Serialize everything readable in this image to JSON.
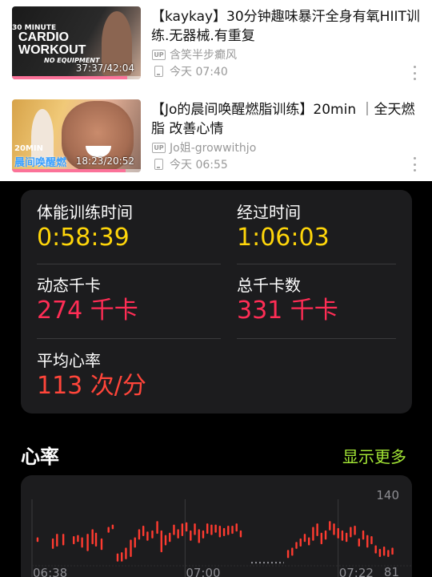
{
  "history": {
    "videos": [
      {
        "title": "【kaykay】30分钟趣味暴汗全身有氧HIIT训练.无器械.有重复",
        "uploader": "含笑半步癫风",
        "watched_time": "今天 07:40",
        "duration": "37:37/42:04",
        "progress": 0.894,
        "thumb_text": {
          "small": "30 MINUTE",
          "line1": "CARDIO",
          "line2": "WORKOUT",
          "sub": "NO EQUIPMENT"
        }
      },
      {
        "title": "【Jo的晨间唤醒燃脂训练】20min ｜全天燃脂 改善心情",
        "uploader": "Jo姐-growwithjo",
        "watched_time": "今天 06:55",
        "duration": "18:23/20:52",
        "progress": 0.881,
        "thumb_text": {
          "line1": "20MIN",
          "line2": "晨间唤醒燃"
        }
      }
    ],
    "up_badge": "UP",
    "icons": [
      "up-badge-icon",
      "device-icon",
      "more-vertical-icon"
    ]
  },
  "summary": {
    "workout_time_label": "体能训练时间",
    "workout_time_value": "0:58:39",
    "elapsed_label": "经过时间",
    "elapsed_value": "1:06:03",
    "active_kcal_label": "动态千卡",
    "active_kcal_value": "274 千卡",
    "total_kcal_label": "总千卡数",
    "total_kcal_value": "331 千卡",
    "avg_hr_label": "平均心率",
    "avg_hr_value": "113 次/分"
  },
  "heart_rate": {
    "title": "心率",
    "show_more": "显示更多"
  },
  "colors": {
    "yellow": "#ffd60a",
    "pink": "#ff2d55",
    "red": "#ff453a",
    "green": "#a3e635",
    "card_bg": "#1c1c1e",
    "bili_pink": "#fb7299"
  },
  "chart_data": {
    "type": "bar",
    "title": "",
    "x_tick_labels": [
      "06:38",
      "07:00",
      "07:22"
    ],
    "y_tick_labels": [
      "140",
      "81"
    ],
    "ylim": [
      81,
      140
    ],
    "bars": [
      [
        0.8,
        110,
        114
      ],
      [
        3.0,
        104,
        113
      ],
      [
        3.6,
        106,
        117
      ],
      [
        4.5,
        107,
        117
      ],
      [
        6.0,
        108,
        115
      ],
      [
        6.6,
        110,
        116
      ],
      [
        7.2,
        105,
        114
      ],
      [
        8.0,
        102,
        117
      ],
      [
        8.7,
        108,
        121
      ],
      [
        9.2,
        106,
        118
      ],
      [
        10.0,
        103,
        113
      ],
      [
        11.0,
        118,
        123
      ],
      [
        11.6,
        121,
        125
      ],
      [
        12.3,
        93,
        100
      ],
      [
        12.9,
        93,
        101
      ],
      [
        13.5,
        95,
        105
      ],
      [
        14.2,
        97,
        112
      ],
      [
        14.8,
        105,
        114
      ],
      [
        15.4,
        112,
        121
      ],
      [
        16.0,
        115,
        124
      ],
      [
        16.6,
        111,
        119
      ],
      [
        17.3,
        113,
        120
      ],
      [
        18.0,
        117,
        128
      ],
      [
        18.6,
        101,
        120
      ],
      [
        19.2,
        107,
        116
      ],
      [
        19.8,
        110,
        118
      ],
      [
        20.4,
        116,
        125
      ],
      [
        21.0,
        113,
        121
      ],
      [
        21.6,
        115,
        126
      ],
      [
        22.2,
        119,
        127
      ],
      [
        22.8,
        111,
        120
      ],
      [
        23.4,
        116,
        126
      ],
      [
        24.0,
        109,
        121
      ],
      [
        24.6,
        113,
        120
      ],
      [
        25.2,
        117,
        126
      ],
      [
        25.8,
        116,
        125
      ],
      [
        26.4,
        118,
        125
      ],
      [
        27.0,
        114,
        124
      ],
      [
        27.6,
        115,
        122
      ],
      [
        28.2,
        116,
        124
      ],
      [
        28.8,
        117,
        124
      ],
      [
        29.4,
        119,
        126
      ],
      [
        30.0,
        114,
        120
      ],
      [
        36.8,
        96,
        103
      ],
      [
        37.4,
        98,
        105
      ],
      [
        38.0,
        104,
        110
      ],
      [
        38.6,
        106,
        113
      ],
      [
        39.2,
        110,
        117
      ],
      [
        39.8,
        107,
        114
      ],
      [
        40.4,
        111,
        123
      ],
      [
        41.0,
        115,
        126
      ],
      [
        41.6,
        108,
        118
      ],
      [
        42.2,
        112,
        120
      ],
      [
        42.8,
        120,
        128
      ],
      [
        43.4,
        116,
        126
      ],
      [
        44.0,
        113,
        122
      ],
      [
        44.6,
        111,
        120
      ],
      [
        45.2,
        110,
        118
      ],
      [
        45.8,
        114,
        123
      ],
      [
        46.4,
        116,
        124
      ],
      [
        47.0,
        106,
        113
      ],
      [
        47.6,
        112,
        120
      ],
      [
        48.2,
        105,
        116
      ],
      [
        48.8,
        108,
        115
      ],
      [
        49.4,
        100,
        107
      ],
      [
        50.0,
        97,
        104
      ],
      [
        50.6,
        98,
        106
      ],
      [
        51.2,
        97,
        103
      ],
      [
        51.8,
        99,
        105
      ]
    ],
    "bar_units": "[minutes since 06:38, low bpm, high bpm]",
    "gap_dotted_range": [
      31.5,
      36.2
    ],
    "gap_value": 92,
    "x_range": [
      0,
      53
    ],
    "grid_vertical_at": [
      0,
      22,
      44
    ]
  }
}
